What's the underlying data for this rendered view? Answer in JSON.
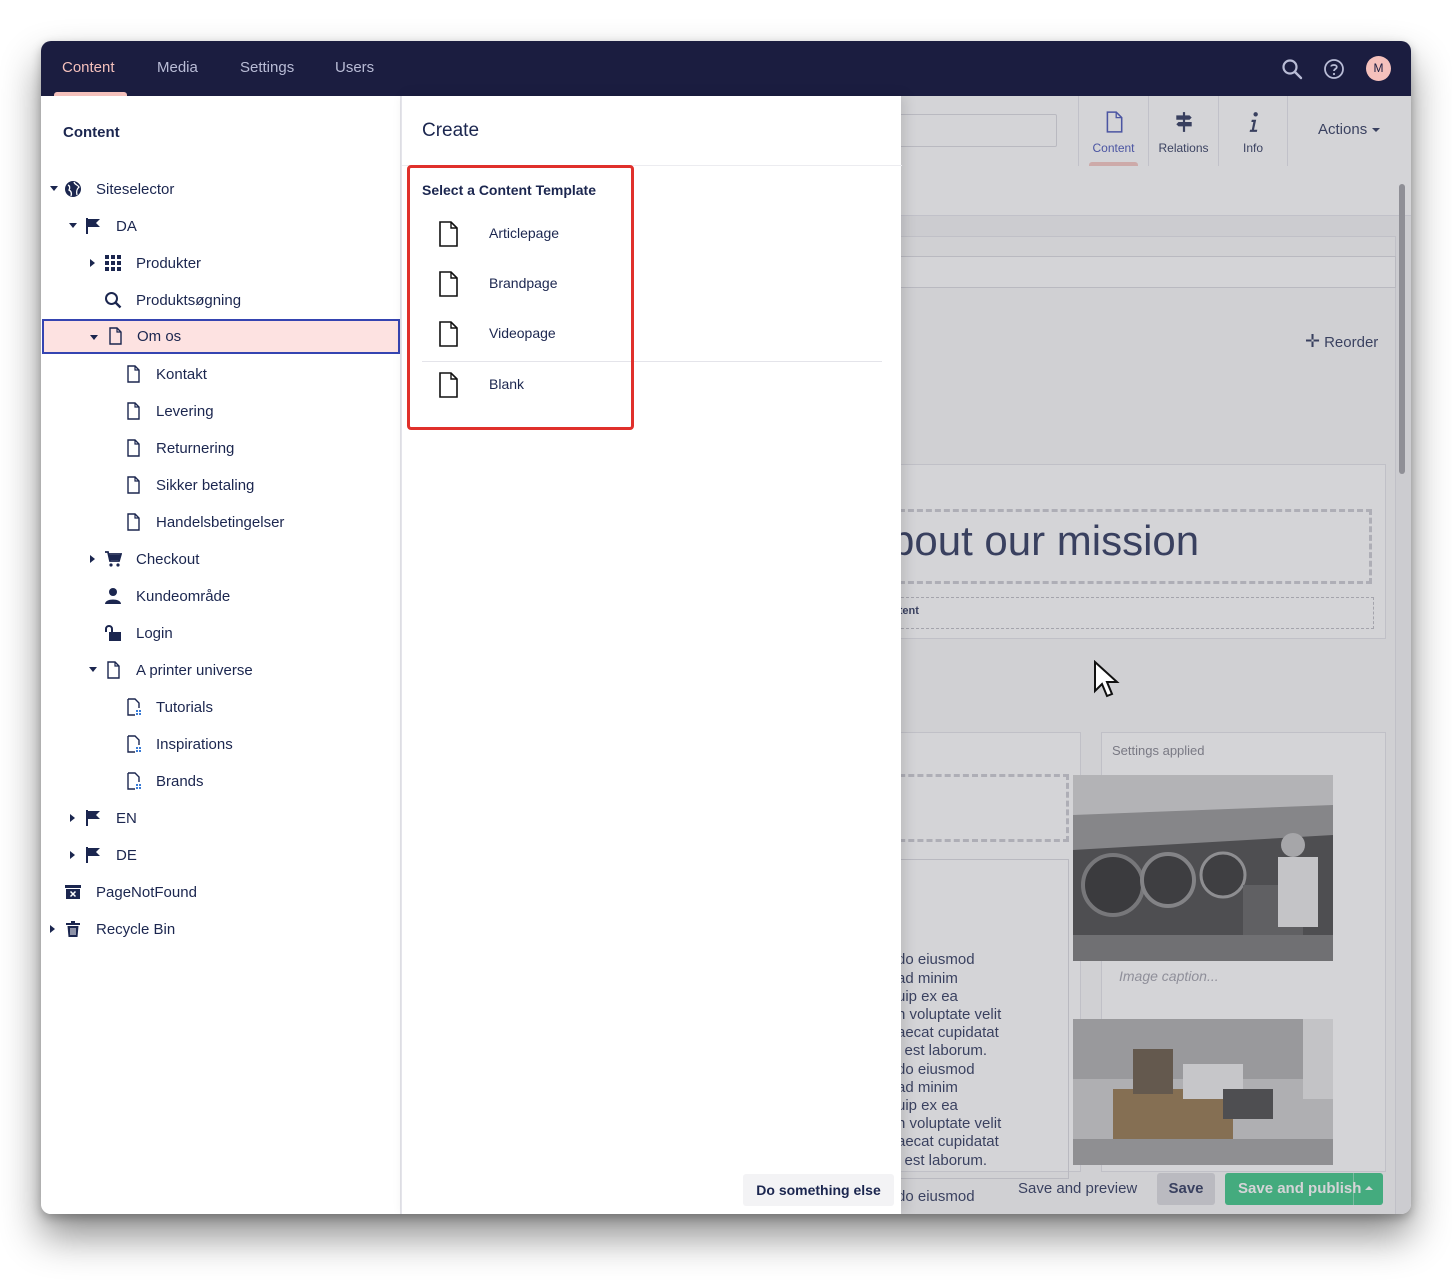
{
  "topnav": {
    "items": [
      "Content",
      "Media",
      "Settings",
      "Users"
    ],
    "active": "Content",
    "avatar_initial": "M"
  },
  "tree": {
    "title": "Content",
    "nodes": [
      {
        "label": "Siteselector",
        "icon": "globe-icon"
      },
      {
        "label": "DA",
        "icon": "flag-icon"
      },
      {
        "label": "Produkter",
        "icon": "grid-icon"
      },
      {
        "label": "Produktsøgning",
        "icon": "search-icon"
      },
      {
        "label": "Om os",
        "icon": "document-icon"
      },
      {
        "label": "Kontakt",
        "icon": "document-icon"
      },
      {
        "label": "Levering",
        "icon": "document-icon"
      },
      {
        "label": "Returnering",
        "icon": "document-icon"
      },
      {
        "label": "Sikker betaling",
        "icon": "document-icon"
      },
      {
        "label": "Handelsbetingelser",
        "icon": "document-icon"
      },
      {
        "label": "Checkout",
        "icon": "cart-icon"
      },
      {
        "label": "Kundeområde",
        "icon": "user-icon"
      },
      {
        "label": "Login",
        "icon": "unlock-icon"
      },
      {
        "label": "A printer universe",
        "icon": "document-icon"
      },
      {
        "label": "Tutorials",
        "icon": "document-grid-icon"
      },
      {
        "label": "Inspirations",
        "icon": "document-grid-icon"
      },
      {
        "label": "Brands",
        "icon": "document-grid-icon"
      },
      {
        "label": "EN",
        "icon": "flag-icon"
      },
      {
        "label": "DE",
        "icon": "flag-icon"
      },
      {
        "label": "PageNotFound",
        "icon": "page-not-found-icon"
      },
      {
        "label": "Recycle Bin",
        "icon": "trash-icon"
      }
    ]
  },
  "editor": {
    "tabs": [
      {
        "label": "Content",
        "icon": "document-icon"
      },
      {
        "label": "Relations",
        "icon": "signpost-icon"
      },
      {
        "label": "Info",
        "icon": "info-icon"
      }
    ],
    "actions_label": "Actions",
    "reorder_label": "Reorder",
    "heading_fragment": "bout our mission",
    "content_fragment": "ntent",
    "settings_applied": "Settings applied",
    "image_caption_placeholder": "Image caption...",
    "lorem_lines": [
      "do eiusmod",
      "ad minim",
      "uip ex ea",
      "n voluptate velit",
      "aecat cupidatat",
      "l est laborum.",
      "do eiusmod",
      "ad minim",
      "uip ex ea",
      "n voluptate velit",
      "aecat cupidatat",
      "l est laborum.",
      "",
      "do eiusmod"
    ]
  },
  "create_dialog": {
    "title": "Create",
    "subtitle": "Select a Content Template",
    "templates": [
      "Articlepage",
      "Brandpage",
      "Videopage",
      "Blank"
    ],
    "secondary_button": "Do something else"
  },
  "footer": {
    "save_preview": "Save and preview",
    "save": "Save",
    "save_publish": "Save and publish"
  },
  "colors": {
    "topbar": "#1b1d40",
    "accent": "#f5c1bc",
    "publish": "#2bc37c",
    "highlight": "#e0302b",
    "selected_bg": "#fde2e1",
    "selected_border": "#3544b1"
  }
}
